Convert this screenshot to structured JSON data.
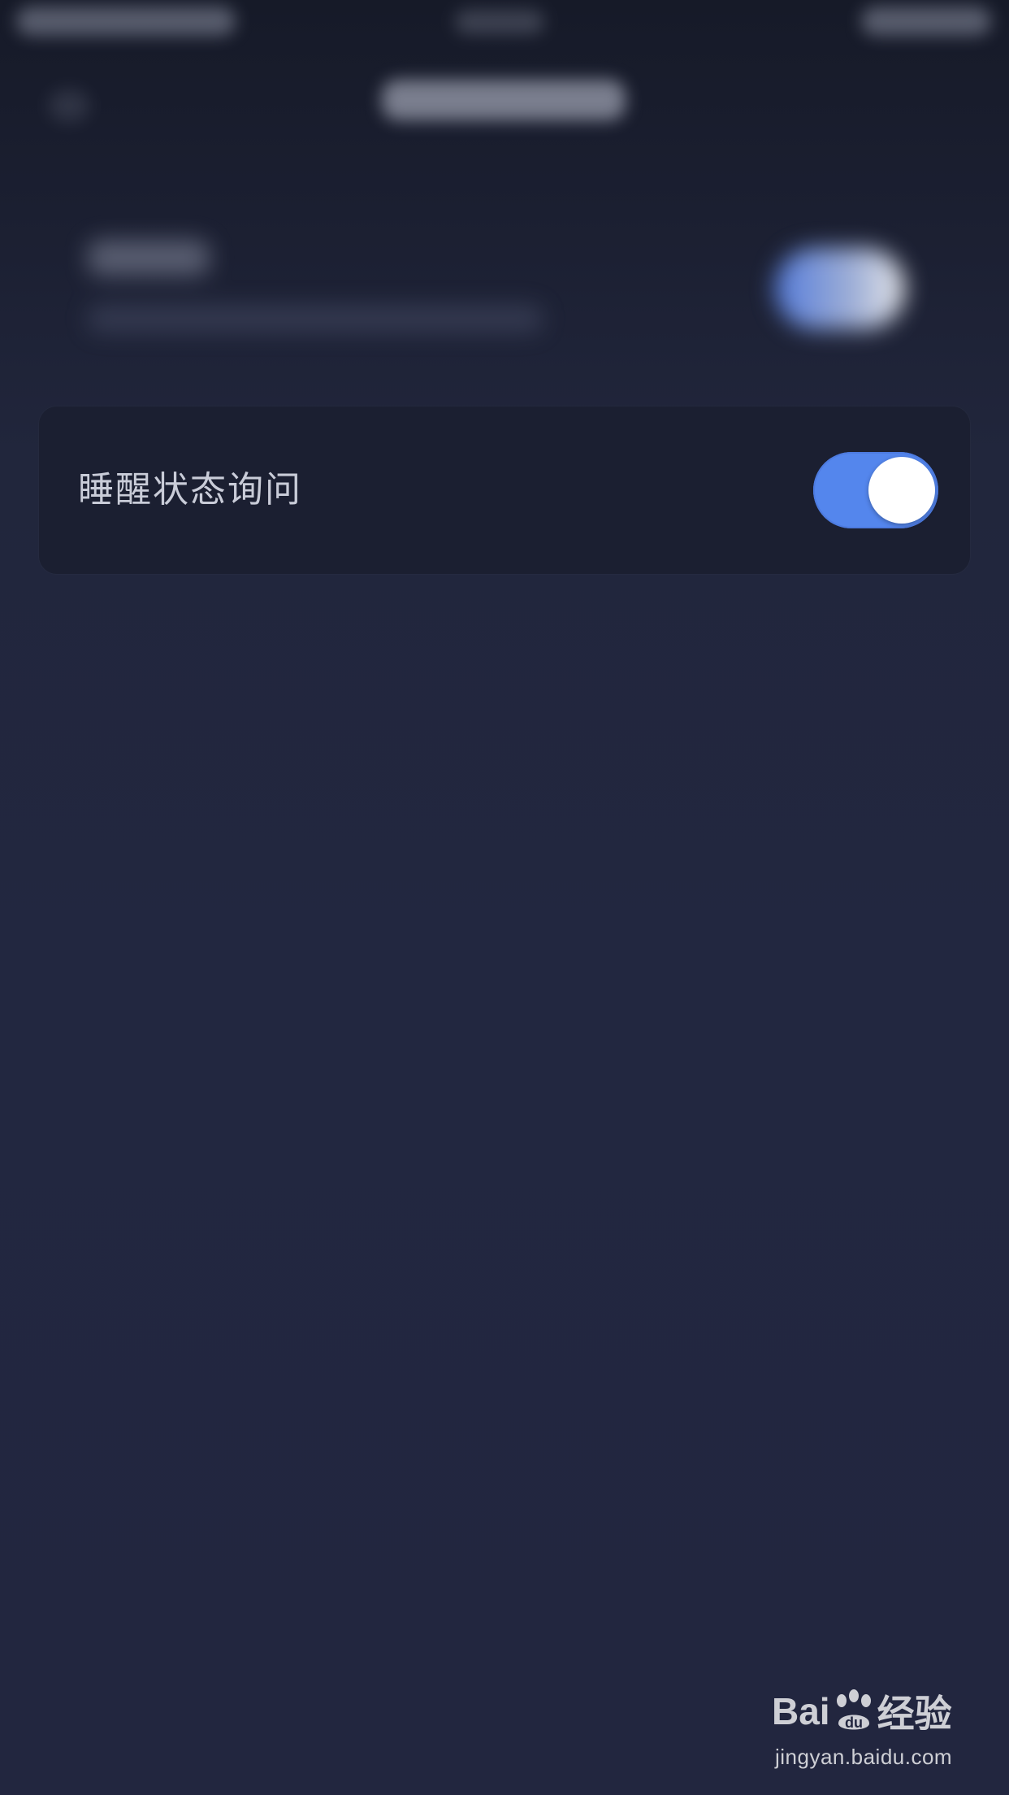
{
  "setting": {
    "label": "睡醒状态询问",
    "toggle_on": true
  },
  "colors": {
    "background": "#22263f",
    "card": "#1b1f31",
    "label": "#c9ccd8",
    "toggle_accent": "#5486ed"
  },
  "watermark": {
    "brand_left": "Bai",
    "brand_mid": "du",
    "brand_right": "经验",
    "url": "jingyan.baidu.com"
  }
}
